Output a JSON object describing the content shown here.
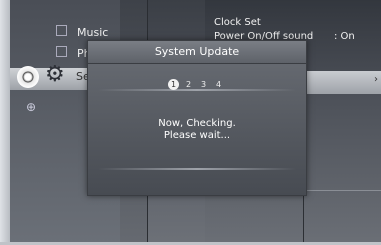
{
  "menu": {
    "items": [
      {
        "label": "Music",
        "icon": "music-icon"
      },
      {
        "label": "Ph",
        "icon": "photo-icon"
      },
      {
        "label": "Se",
        "icon": "gear-icon"
      }
    ]
  },
  "settings": {
    "clock_set": "Clock Set",
    "power_sound": "Power On/Off sound",
    "power_sound_value": ": On"
  },
  "dialog": {
    "title": "System Update",
    "steps": [
      "1",
      "2",
      "3",
      "4"
    ],
    "active_step": 1,
    "message_line1": "Now, Checking.",
    "message_line2": "Please wait..."
  }
}
